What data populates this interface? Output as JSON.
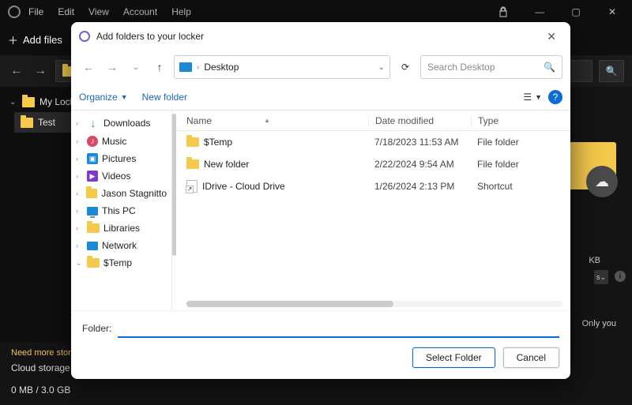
{
  "app": {
    "menu": [
      "File",
      "Edit",
      "View",
      "Account",
      "Help"
    ],
    "add_files": "Add files",
    "breadcrumb": "My Lock",
    "tree_item": "Test",
    "need_storage": "Need more storag",
    "cloud_storage": "Cloud storage",
    "meter": "0 MB / 3.0 GB",
    "kb": "KB",
    "s_label": "s",
    "only_you": "Only you"
  },
  "dialog": {
    "title": "Add folders to your locker",
    "location": "Desktop",
    "search_placeholder": "Search Desktop",
    "organize": "Organize",
    "new_folder": "New folder",
    "tree": [
      {
        "label": "Downloads",
        "icon": "dl",
        "exp": "›"
      },
      {
        "label": "Music",
        "icon": "music",
        "exp": "›"
      },
      {
        "label": "Pictures",
        "icon": "pic",
        "exp": "›"
      },
      {
        "label": "Videos",
        "icon": "vid",
        "exp": "›"
      },
      {
        "label": "Jason Stagnitto",
        "icon": "folder",
        "exp": "›"
      },
      {
        "label": "This PC",
        "icon": "pc",
        "exp": "›"
      },
      {
        "label": "Libraries",
        "icon": "folder",
        "exp": "›"
      },
      {
        "label": "Network",
        "icon": "net",
        "exp": "›"
      },
      {
        "label": "$Temp",
        "icon": "folder",
        "exp": "⌄"
      }
    ],
    "columns": {
      "name": "Name",
      "date": "Date modified",
      "type": "Type"
    },
    "rows": [
      {
        "name": "$Temp",
        "icon": "folder",
        "date": "7/18/2023 11:53 AM",
        "type": "File folder"
      },
      {
        "name": "New folder",
        "icon": "folder",
        "date": "2/22/2024 9:54 AM",
        "type": "File folder"
      },
      {
        "name": "IDrive - Cloud Drive",
        "icon": "shortcut",
        "date": "1/26/2024 2:13 PM",
        "type": "Shortcut"
      }
    ],
    "folder_label": "Folder:",
    "folder_value": "",
    "select_btn": "Select Folder",
    "cancel_btn": "Cancel"
  }
}
